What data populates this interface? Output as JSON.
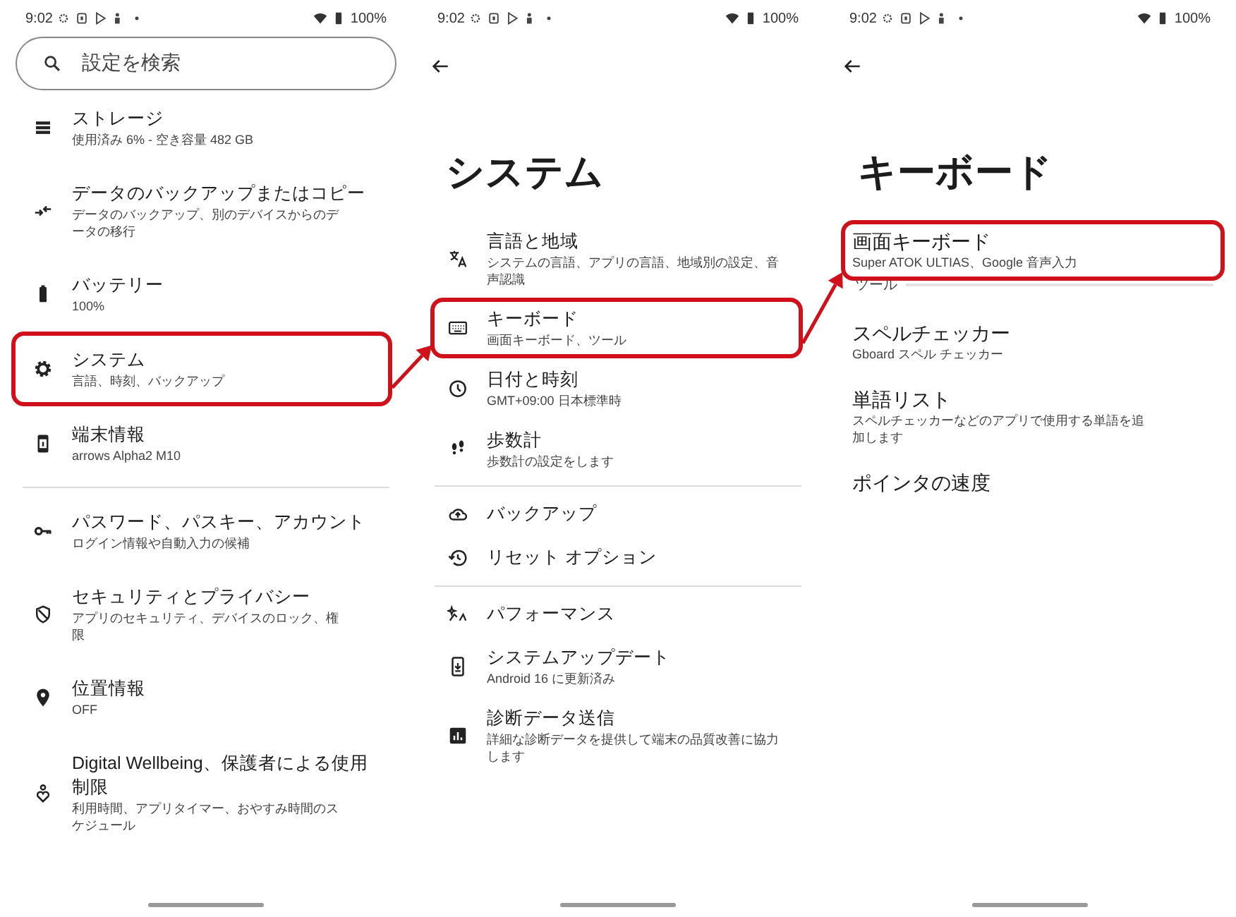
{
  "screens": [
    {
      "status_bar": {
        "time": "9:02",
        "battery": "100%"
      },
      "search": {
        "placeholder": "設定を検索"
      },
      "items": [
        {
          "title": "ストレージ",
          "subtitle": "使用済み 6% - 空き容量 482 GB"
        },
        {
          "title": "データのバックアップまたはコピー",
          "subtitle": "データのバックアップ、別のデバイスからのデータの移行"
        },
        {
          "title": "バッテリー",
          "subtitle": "100%"
        },
        {
          "title": "システム",
          "subtitle": "言語、時刻、バックアップ",
          "highlighted": true
        },
        {
          "title": "端末情報",
          "subtitle": "arrows Alpha2 M10",
          "divider_after": true
        },
        {
          "title": "パスワード、パスキー、アカウント",
          "subtitle": "ログイン情報や自動入力の候補"
        },
        {
          "title": "セキュリティとプライバシー",
          "subtitle": "アプリのセキュリティ、デバイスのロック、権限"
        },
        {
          "title": "位置情報",
          "subtitle": "OFF"
        },
        {
          "title": "Digital Wellbeing、保護者による使用制限",
          "subtitle": "利用時間、アプリタイマー、おやすみ時間のスケジュール"
        }
      ]
    },
    {
      "status_bar": {
        "time": "9:02",
        "battery": "100%"
      },
      "title": "システム",
      "items": [
        {
          "title": "言語と地域",
          "subtitle": "システムの言語、アプリの言語、地域別の設定、音声認識"
        },
        {
          "title": "キーボード",
          "subtitle": "画面キーボード、ツール",
          "highlighted": true
        },
        {
          "title": "日付と時刻",
          "subtitle": "GMT+09:00 日本標準時"
        },
        {
          "title": "歩数計",
          "subtitle": "歩数計の設定をします",
          "divider_after": true
        },
        {
          "title": "バックアップ"
        },
        {
          "title": "リセット オプション",
          "divider_after": true
        },
        {
          "title": "パフォーマンス"
        },
        {
          "title": "システムアップデート",
          "subtitle": "Android 16 に更新済み"
        },
        {
          "title": "診断データ送信",
          "subtitle": "詳細な診断データを提供して端末の品質改善に協力します"
        }
      ]
    },
    {
      "status_bar": {
        "time": "9:02",
        "battery": "100%"
      },
      "title": "キーボード",
      "items": [
        {
          "kind": "entry",
          "title": "画面キーボード",
          "subtitle": "Super ATOK ULTIAS、Google 音声入力",
          "highlighted": true
        },
        {
          "kind": "header",
          "title": "ツール"
        },
        {
          "kind": "entry",
          "title": "スペルチェッカー",
          "subtitle": "Gboard スペル チェッカー"
        },
        {
          "kind": "entry",
          "title": "単語リスト",
          "subtitle": "スペルチェッカーなどのアプリで使用する単語を追加します"
        },
        {
          "kind": "entry",
          "title": "ポインタの速度"
        }
      ]
    }
  ]
}
